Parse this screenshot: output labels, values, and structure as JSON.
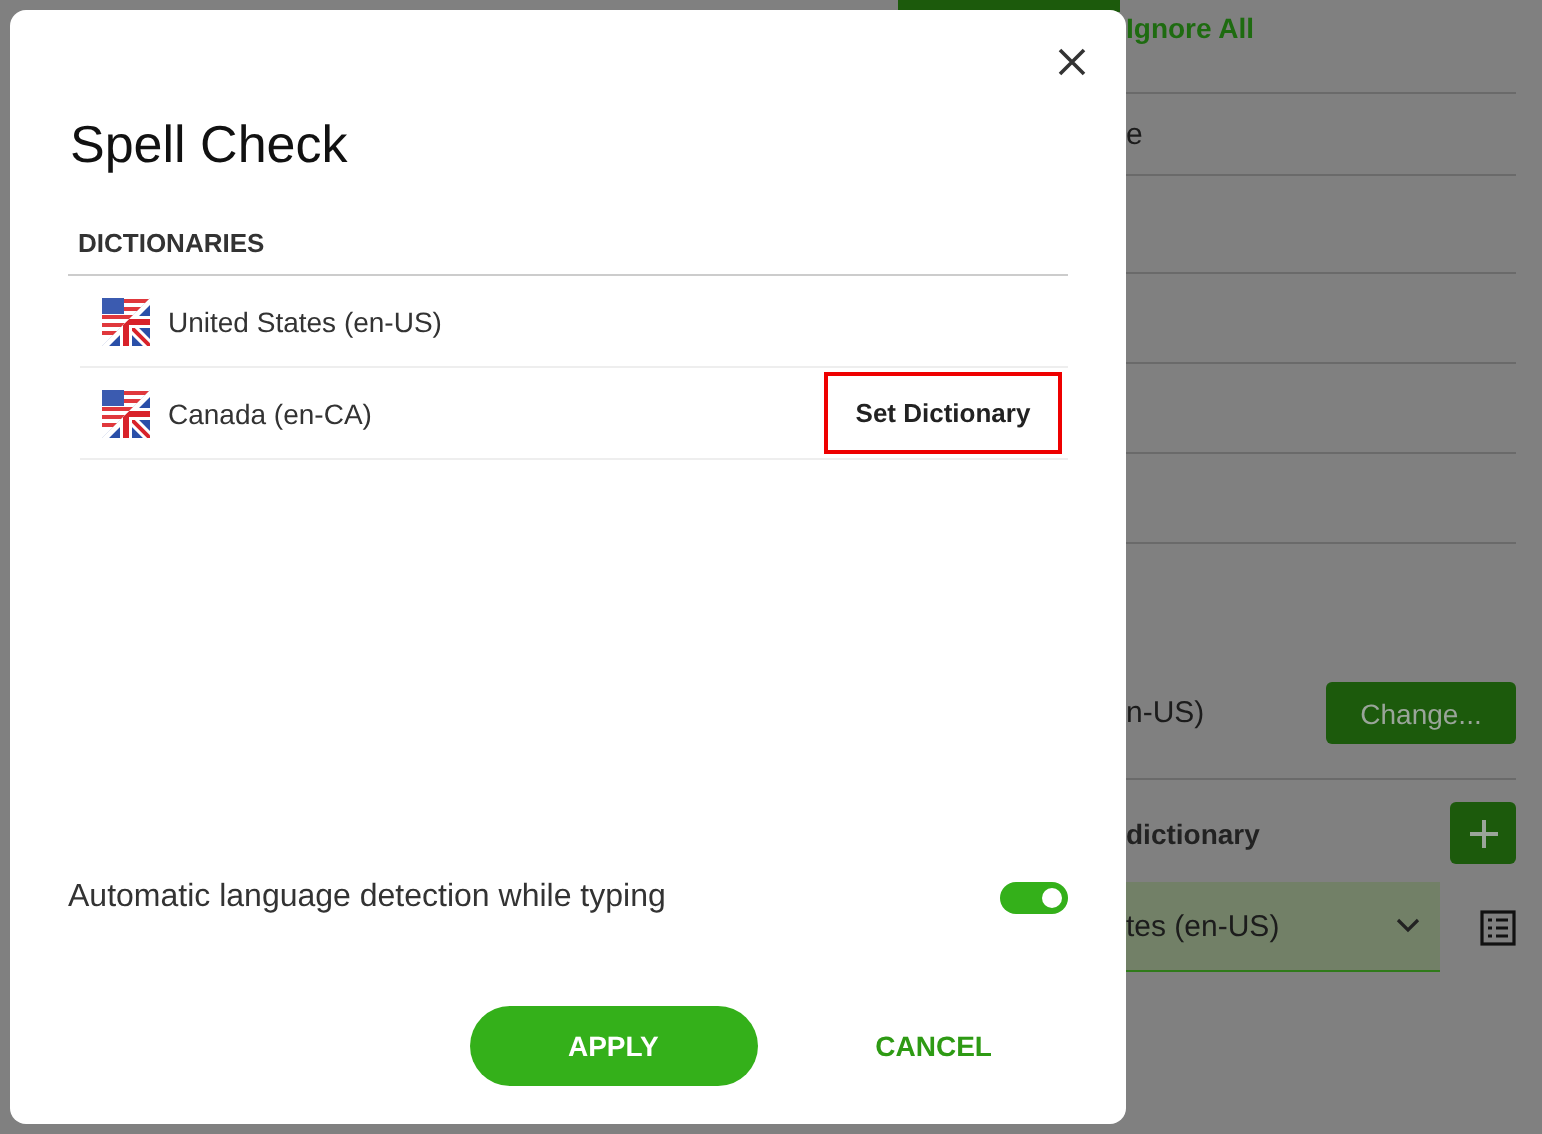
{
  "background": {
    "ignore_all_link": "Ignore All",
    "row_text": "e",
    "language_text": "n-US)",
    "change_button": "Change...",
    "dictionary_label": "dictionary",
    "dictionary_select": "tes (en-US)"
  },
  "dialog": {
    "title": "Spell Check",
    "section_heading": "DICTIONARIES",
    "dictionaries": [
      {
        "name": "United States (en-US)"
      },
      {
        "name": "Canada (en-CA)",
        "action": "Set Dictionary",
        "highlighted": true
      }
    ],
    "auto_detect": {
      "label": "Automatic language detection while typing",
      "on": true
    },
    "buttons": [
      {
        "label": "APPLY",
        "kind": "primary"
      },
      {
        "label": "CANCEL",
        "kind": "text"
      }
    ]
  }
}
